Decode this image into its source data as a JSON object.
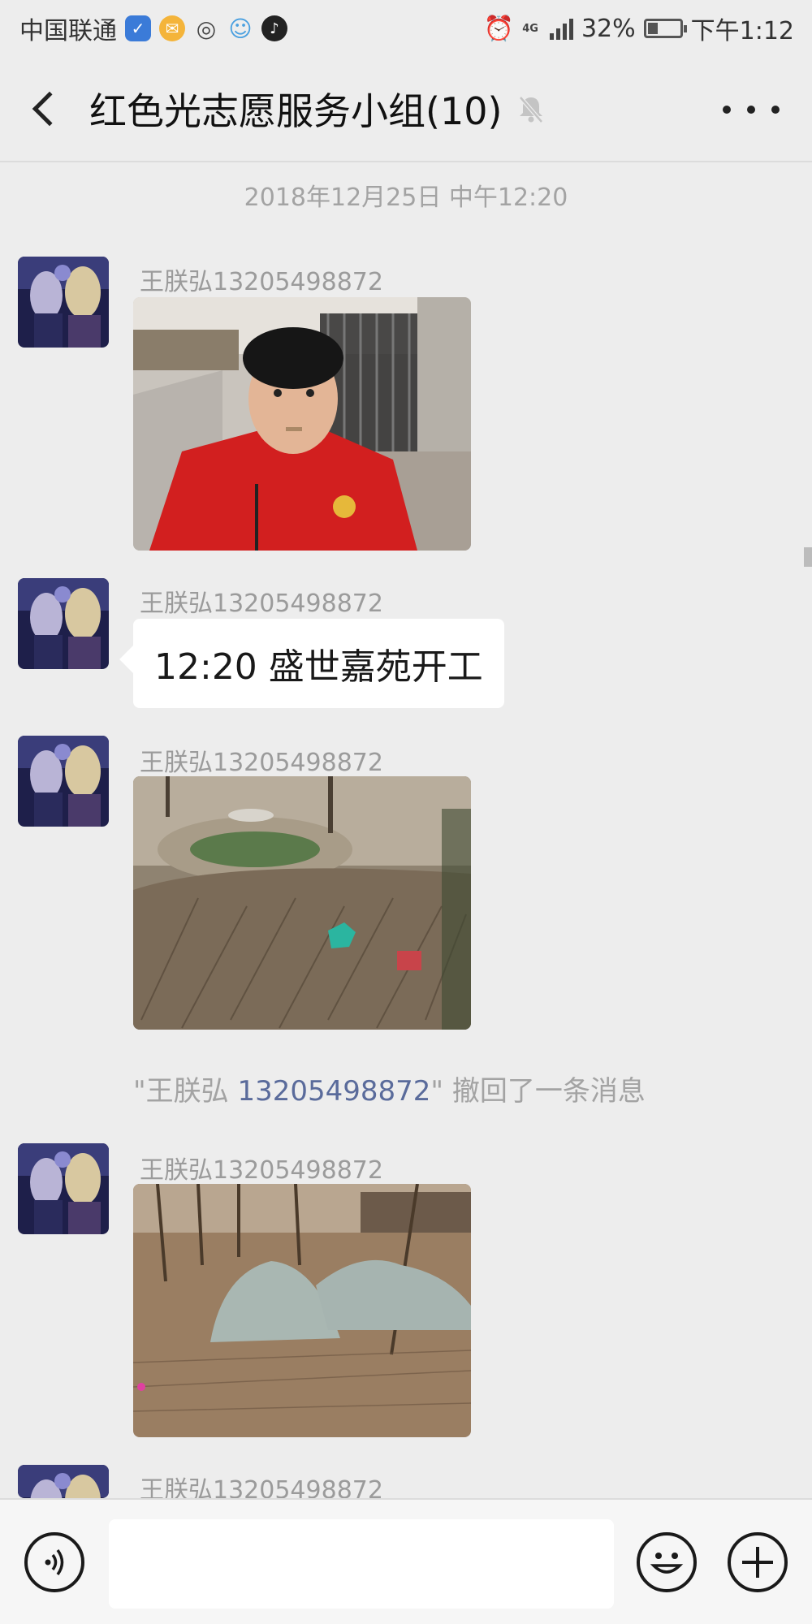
{
  "status_bar": {
    "carrier": "中国联通",
    "network": "4G",
    "battery": "32%",
    "battery_level": 0.32,
    "time": "下午1:12",
    "icons": [
      "shield-icon",
      "mail-icon",
      "wechat-icon",
      "pet-icon",
      "tiktok-icon",
      "alarm-icon",
      "signal-icon",
      "battery-icon"
    ]
  },
  "header": {
    "title": "红色光志愿服务小组(10)",
    "icons": [
      "back-chevron-icon",
      "mute-bell-icon",
      "more-dots-icon"
    ]
  },
  "chat": {
    "timestamp": "2018年12月25日 中午12:20",
    "messages": [
      {
        "type": "image",
        "sender": "王朕弘13205498872",
        "image": "selfie-photo"
      },
      {
        "type": "text",
        "sender": "王朕弘13205498872",
        "text": "12:20 盛世嘉苑开工"
      },
      {
        "type": "image",
        "sender": "王朕弘13205498872",
        "image": "shrubs-photo"
      },
      {
        "type": "image",
        "sender": "王朕弘13205498872",
        "image": "covered-plants-photo"
      },
      {
        "type": "partial",
        "sender": "王朕弘13205498872"
      }
    ],
    "recall": {
      "prefix": "\"王朕弘 ",
      "phone": "13205498872",
      "suffix": "\" 撤回了一条消息"
    }
  },
  "input_bar": {
    "placeholder": "",
    "icons": [
      "voice-icon",
      "emoji-icon",
      "plus-icon"
    ]
  },
  "colors": {
    "background": "#ededed",
    "bubble": "#ffffff",
    "link": "#5a6b9b"
  }
}
